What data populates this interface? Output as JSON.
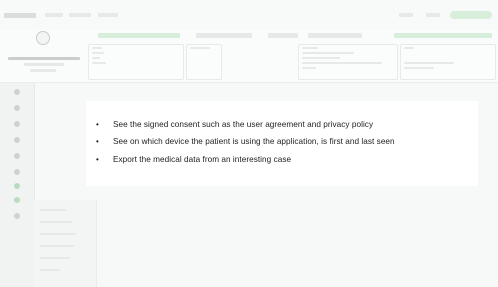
{
  "modal": {
    "items": [
      {
        "bullet": "•",
        "text": "See the signed consent such as the user agreement and privacy policy"
      },
      {
        "bullet": "•",
        "text": "See on which device the patient is using the application, is first and last seen"
      },
      {
        "bullet": "•",
        "text": "Export the medical data from an interesting case"
      }
    ]
  },
  "background": {
    "accent_color": "#d7eeda",
    "status": "blurred application screen behind content card"
  }
}
